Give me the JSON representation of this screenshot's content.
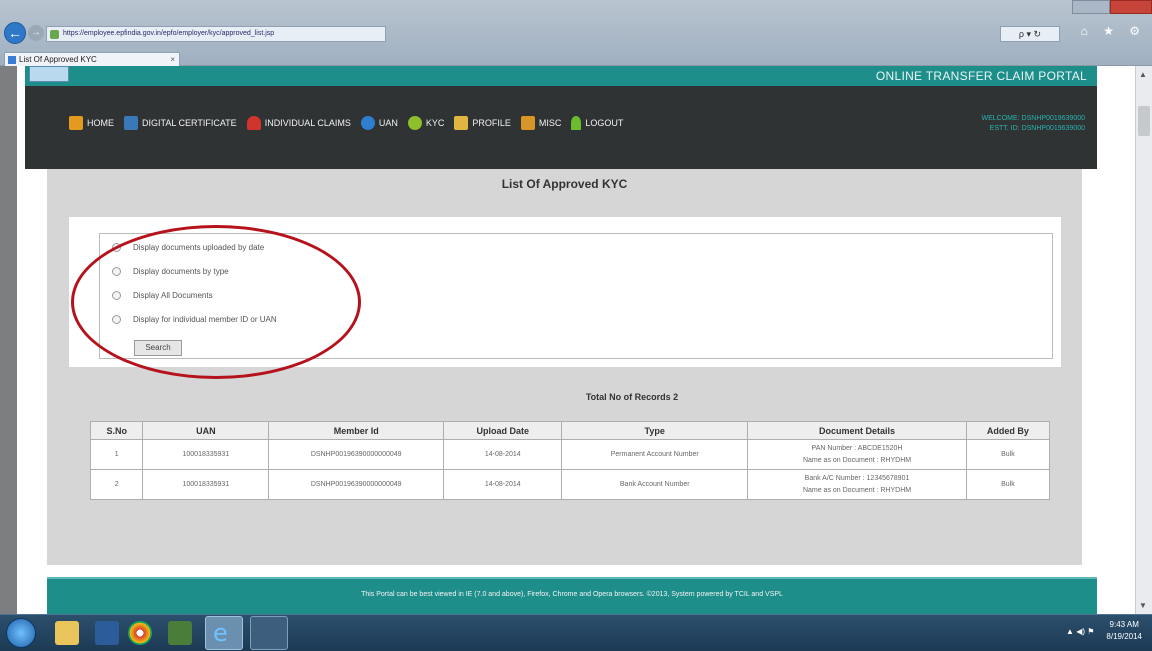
{
  "browser": {
    "address_url": "https://employee.epfindia.gov.in/epfo/employer/kyc/approved_list.jsp",
    "address_right": "ρ ▾ ↻",
    "tab_title": "List Of Approved KYC",
    "tab_close": "×",
    "back_glyph": "←",
    "forward_glyph": "→",
    "controls": "⌂ ★ ⚙"
  },
  "site": {
    "portal_title": "ONLINE TRANSFER CLAIM PORTAL",
    "nav": [
      {
        "label": "HOME",
        "icon": "home-icon"
      },
      {
        "label": "DIGITAL CERTIFICATE",
        "icon": "certificate-icon"
      },
      {
        "label": "INDIVIDUAL CLAIMS",
        "icon": "person-icon"
      },
      {
        "label": "UAN",
        "icon": "uan-icon"
      },
      {
        "label": "KYC",
        "icon": "kyc-icon"
      },
      {
        "label": "PROFILE",
        "icon": "profile-icon"
      },
      {
        "label": "MISC",
        "icon": "misc-icon"
      },
      {
        "label": "LOGOUT",
        "icon": "logout-icon"
      }
    ],
    "welcome_line1": "WELCOME: DSNHP0019639000",
    "welcome_line2": "ESTT. ID: DSNHP0019639000"
  },
  "main": {
    "heading": "List Of Approved KYC",
    "options": [
      "Display documents uploaded by date",
      "Display documents by type",
      "Display All Documents",
      "Display for individual member ID or UAN"
    ],
    "search_label": "Search",
    "records_label": "Total No of Records 2",
    "table": {
      "headers": [
        "S.No",
        "UAN",
        "Member Id",
        "Upload Date",
        "Type",
        "Document Details",
        "Added By"
      ],
      "rows": [
        {
          "sno": "1",
          "uan": "100018335931",
          "member_id": "DSNHP00196390000000049",
          "upload_date": "14-08-2014",
          "type": "Permanent Account Number",
          "details_line1": "PAN Number : ABCDE1520H",
          "details_line2": "Name as on Document : RHYDHM",
          "added_by": "Bulk"
        },
        {
          "sno": "2",
          "uan": "100018335931",
          "member_id": "DSNHP00196390000000049",
          "upload_date": "14-08-2014",
          "type": "Bank Account Number",
          "details_line1": "Bank A/C Number : 12345678901",
          "details_line2": "Name as on Document : RHYDHM",
          "added_by": "Bulk"
        }
      ]
    }
  },
  "footer": {
    "text": "This Portal can be best viewed in IE (7.0 and above), Firefox, Chrome and Opera browsers.     ©2013, System powered by TCIL and VSPL"
  },
  "taskbar": {
    "time": "9:43 AM",
    "date": "8/19/2014",
    "tray_glyphs": "▲ ◀) ⚑"
  },
  "annotation": {
    "highlight_color": "#b5121b"
  }
}
